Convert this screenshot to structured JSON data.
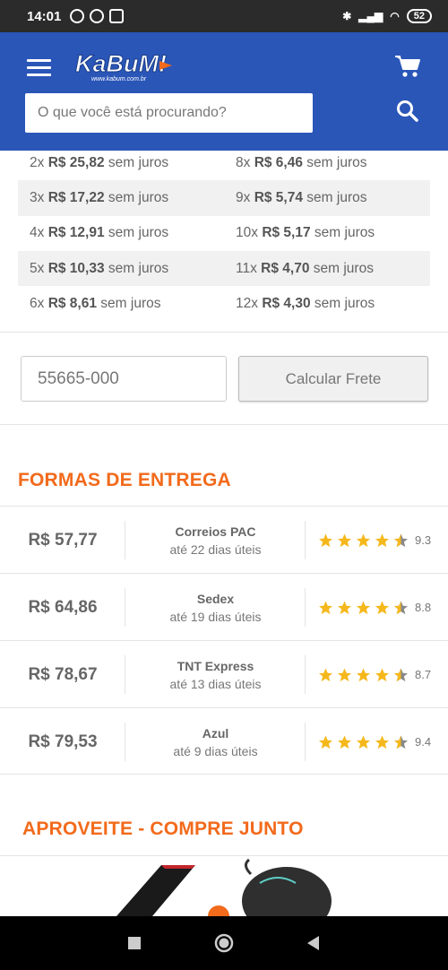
{
  "status": {
    "time": "14:01",
    "battery": "52"
  },
  "header": {
    "logo_text": "KaBuM!",
    "logo_sub": "www.kabum.com.br",
    "search_placeholder": "O que você está procurando?"
  },
  "installments": [
    {
      "left": {
        "n": "2x",
        "price": "R$ 25,82",
        "suffix": "sem juros"
      },
      "right": {
        "n": "8x",
        "price": "R$ 6,46",
        "suffix": "sem juros"
      }
    },
    {
      "left": {
        "n": "3x",
        "price": "R$ 17,22",
        "suffix": "sem juros"
      },
      "right": {
        "n": "9x",
        "price": "R$ 5,74",
        "suffix": "sem juros"
      }
    },
    {
      "left": {
        "n": "4x",
        "price": "R$ 12,91",
        "suffix": "sem juros"
      },
      "right": {
        "n": "10x",
        "price": "R$ 5,17",
        "suffix": "sem juros"
      }
    },
    {
      "left": {
        "n": "5x",
        "price": "R$ 10,33",
        "suffix": "sem juros"
      },
      "right": {
        "n": "11x",
        "price": "R$ 4,70",
        "suffix": "sem juros"
      }
    },
    {
      "left": {
        "n": "6x",
        "price": "R$ 8,61",
        "suffix": "sem juros"
      },
      "right": {
        "n": "12x",
        "price": "R$ 4,30",
        "suffix": "sem juros"
      }
    }
  ],
  "freight": {
    "cep_value": "55665-000",
    "button_label": "Calcular Frete"
  },
  "delivery": {
    "title": "FORMAS DE ENTREGA",
    "options": [
      {
        "price": "R$ 57,77",
        "name": "Correios PAC",
        "days": "até 22 dias úteis",
        "rating": "9.3"
      },
      {
        "price": "R$ 64,86",
        "name": "Sedex",
        "days": "até 19 dias úteis",
        "rating": "8.8"
      },
      {
        "price": "R$ 78,67",
        "name": "TNT Express",
        "days": "até 13 dias úteis",
        "rating": "8.7"
      },
      {
        "price": "R$ 79,53",
        "name": "Azul",
        "days": "até 9 dias úteis",
        "rating": "9.4"
      }
    ]
  },
  "combo": {
    "title": "APROVEITE - COMPRE JUNTO"
  },
  "colors": {
    "header": "#2a56b8",
    "accent": "#f26a1b",
    "star": "#f5b81c"
  }
}
